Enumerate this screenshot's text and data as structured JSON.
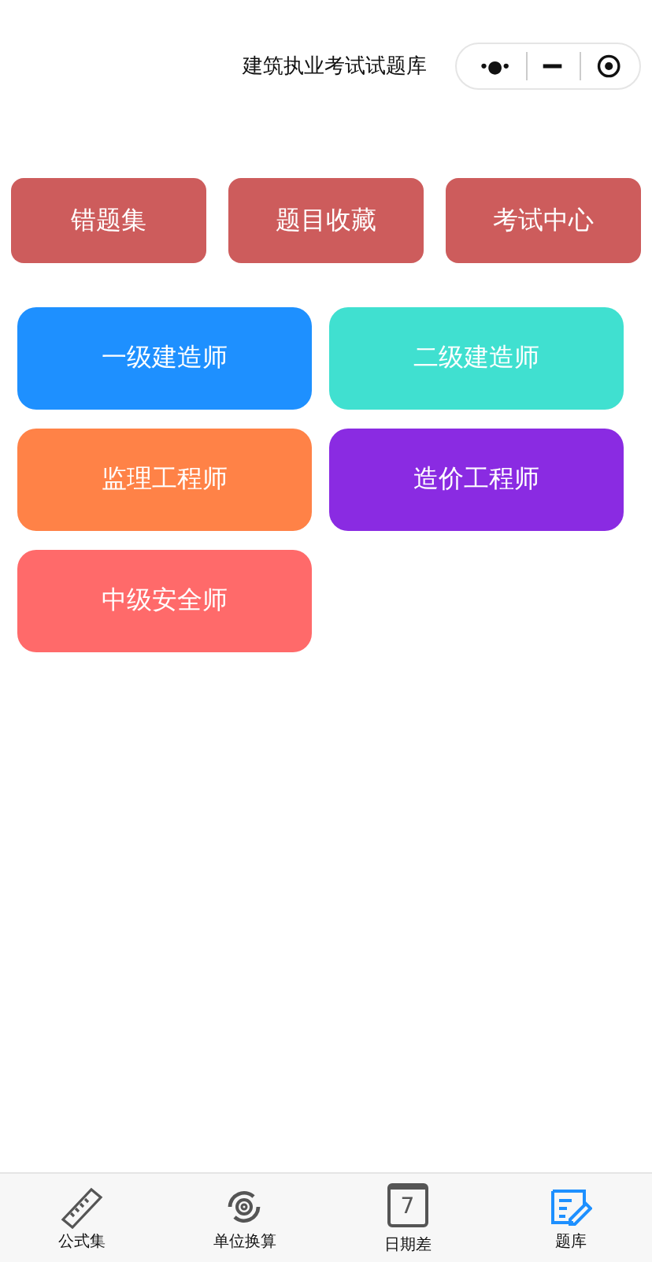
{
  "header": {
    "title": "建筑执业考试试题库",
    "capsule": {
      "more": "•●•"
    }
  },
  "quick_links": [
    "错题集",
    "题目收藏",
    "考试中心"
  ],
  "exams": [
    {
      "label": "一级建造师",
      "color": "#1e90ff"
    },
    {
      "label": "二级建造师",
      "color": "#40e0d0"
    },
    {
      "label": "监理工程师",
      "color": "#ff8247"
    },
    {
      "label": "造价工程师",
      "color": "#8a2be2"
    },
    {
      "label": "中级安全师",
      "color": "#ff6a6a"
    }
  ],
  "tab_bar": [
    {
      "label": "公式集",
      "kind": "ruler",
      "selected": false
    },
    {
      "label": "单位换算",
      "kind": "convert",
      "selected": false
    },
    {
      "label": "日期差",
      "kind": "calendar",
      "icon_text": "7",
      "selected": false
    },
    {
      "label": "题库",
      "kind": "edit",
      "selected": true
    }
  ]
}
